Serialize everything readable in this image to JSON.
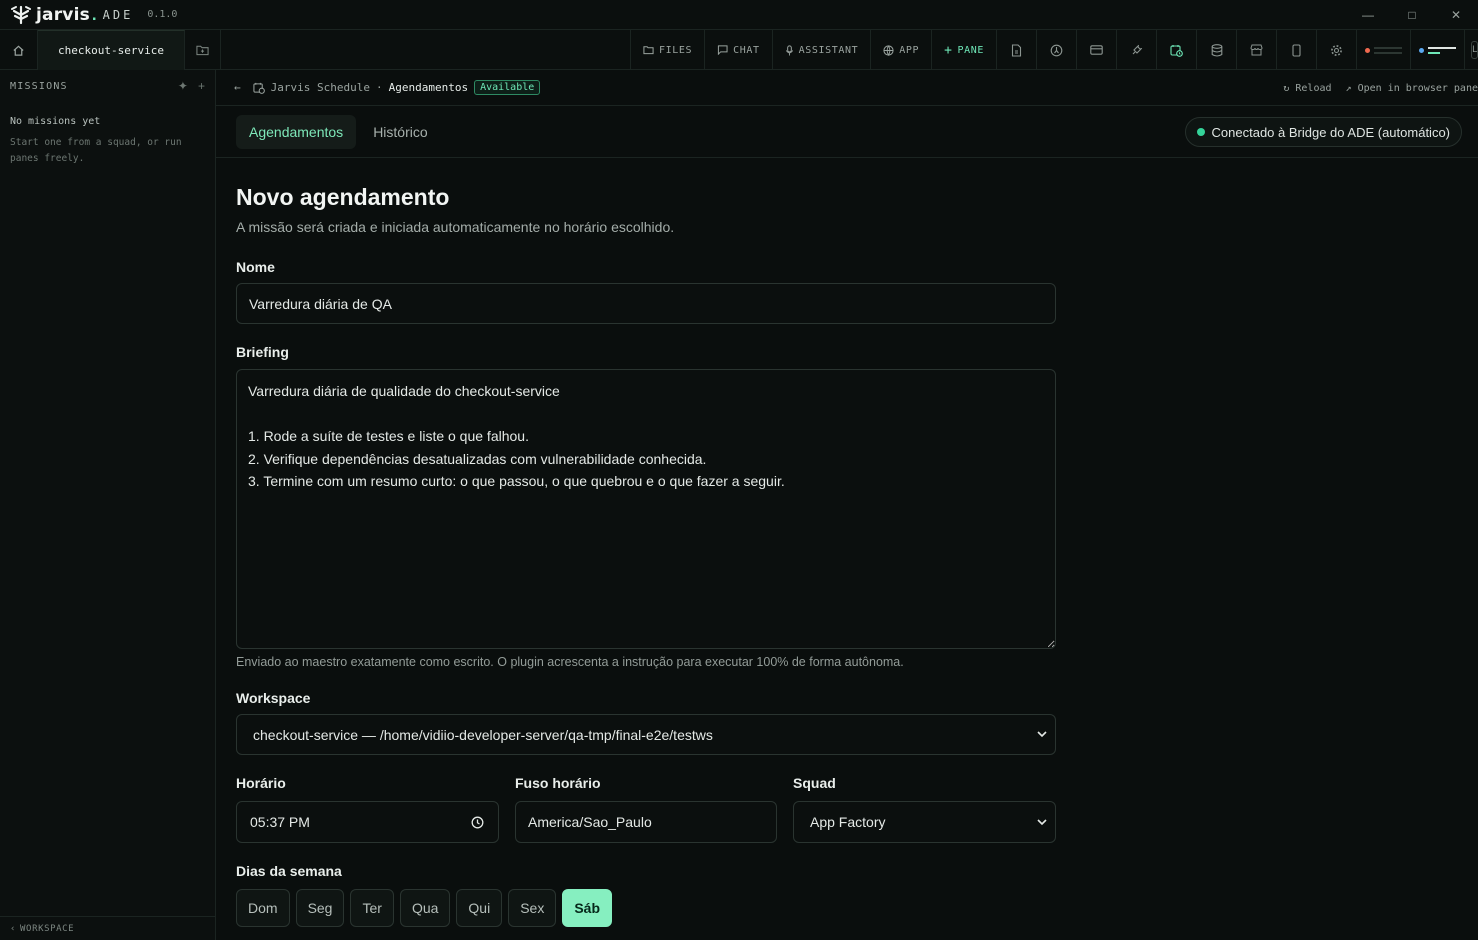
{
  "app": {
    "name": "jarvis",
    "name_suffix": "ADE",
    "version": "0.1.0"
  },
  "toolbar": {
    "tab_label": "checkout-service",
    "buttons": {
      "files": "FILES",
      "chat": "CHAT",
      "assistant": "ASSISTANT",
      "app": "APP",
      "pane": "PANE"
    },
    "edge_label": "L"
  },
  "sidebar": {
    "title": "MISSIONS",
    "empty_title": "No missions yet",
    "empty_sub": "Start one from a squad, or run panes freely.",
    "footer": "WORKSPACE"
  },
  "breadcrumb": {
    "plugin": "Jarvis Schedule",
    "separator": "·",
    "current": "Agendamentos",
    "badge": "Available",
    "reload": "Reload",
    "open_browser": "Open in browser pane"
  },
  "tabs": [
    {
      "label": "Agendamentos",
      "active": true
    },
    {
      "label": "Histórico",
      "active": false
    }
  ],
  "connection": {
    "label": "Conectado à Bridge do ADE (automático)",
    "status_color": "#34d399"
  },
  "form": {
    "title": "Novo agendamento",
    "description": "A missão será criada e iniciada automaticamente no horário escolhido.",
    "name_label": "Nome",
    "name_value": "Varredura diária de QA",
    "briefing_label": "Briefing",
    "briefing_value": "Varredura diária de qualidade do checkout-service\n\n1. Rode a suíte de testes e liste o que falhou.\n2. Verifique dependências desatualizadas com vulnerabilidade conhecida.\n3. Termine com um resumo curto: o que passou, o que quebrou e o que fazer a seguir.",
    "briefing_hint": "Enviado ao maestro exatamente como escrito. O plugin acrescenta a instrução para executar 100% de forma autônoma.",
    "workspace_label": "Workspace",
    "workspace_value": "checkout-service — /home/vidiio-developer-server/qa-tmp/final-e2e/testws",
    "time_label": "Horário",
    "time_value": "05:37 PM",
    "timezone_label": "Fuso horário",
    "timezone_value": "America/Sao_Paulo",
    "squad_label": "Squad",
    "squad_value": "App Factory",
    "days_label": "Dias da semana",
    "days": [
      {
        "label": "Dom",
        "active": false
      },
      {
        "label": "Seg",
        "active": false
      },
      {
        "label": "Ter",
        "active": false
      },
      {
        "label": "Qua",
        "active": false
      },
      {
        "label": "Qui",
        "active": false
      },
      {
        "label": "Sex",
        "active": false
      },
      {
        "label": "Sáb",
        "active": true
      }
    ]
  },
  "colors": {
    "accent": "#6ee7b7",
    "active_day_bg": "#86efc0",
    "background": "#0a0e0d"
  }
}
